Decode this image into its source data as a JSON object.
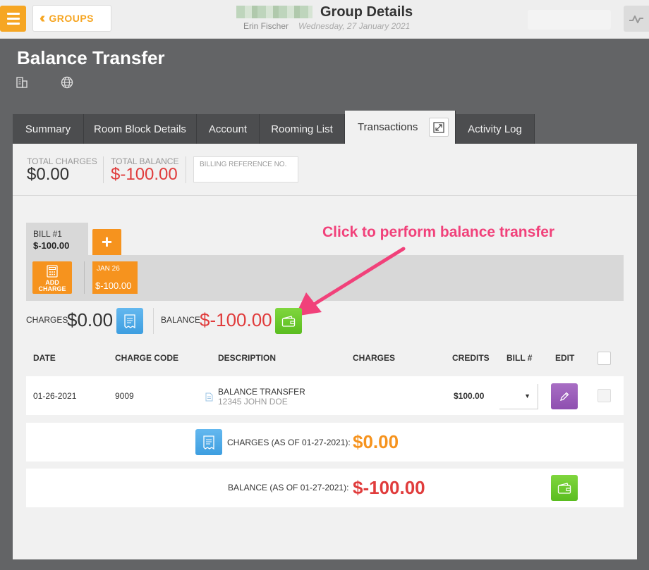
{
  "topbar": {
    "groups_label": "GROUPS",
    "title": "Group Details",
    "user": "Erin Fischer",
    "date": "Wednesday, 27 January 2021"
  },
  "header": {
    "title": "Balance Transfer"
  },
  "tabs": [
    {
      "label": "Summary"
    },
    {
      "label": "Room Block Details"
    },
    {
      "label": "Account"
    },
    {
      "label": "Rooming List"
    },
    {
      "label": "Transactions"
    },
    {
      "label": "Activity Log"
    }
  ],
  "summary": {
    "total_charges_label": "TOTAL CHARGES",
    "total_charges_value": "$0.00",
    "total_balance_label": "TOTAL BALANCE",
    "total_balance_value": "$-100.00",
    "billing_ref_label": "BILLING REFERENCE NO."
  },
  "bill": {
    "label": "BILL #1",
    "amount": "$-100.00",
    "add_charge_label_1": "ADD",
    "add_charge_label_2": "CHARGE",
    "folio_date": "JAN 26",
    "folio_amount": "$-100.00"
  },
  "annotation": "Click to perform balance transfer",
  "totals": {
    "charges_label": "CHARGES",
    "charges_value": "$0.00",
    "balance_label": "BALANCE",
    "balance_value": "$-100.00"
  },
  "table": {
    "headers": [
      "DATE",
      "CHARGE CODE",
      "DESCRIPTION",
      "CHARGES",
      "CREDITS",
      "BILL #",
      "EDIT"
    ],
    "rows": [
      {
        "date": "01-26-2021",
        "code": "9009",
        "description": "BALANCE TRANSFER",
        "sub": "12345 JOHN DOE",
        "charges": "",
        "credits": "$100.00"
      }
    ]
  },
  "footer": {
    "charges_label": "CHARGES (AS OF 01-27-2021):",
    "charges_value": "$0.00",
    "balance_label": "BALANCE (AS OF 01-27-2021):",
    "balance_value": "$-100.00"
  },
  "colors": {
    "accent_orange": "#f6931e",
    "negative_red": "#e03c3c",
    "annotation_pink": "#f1417a",
    "transfer_green": "#5bbd20"
  }
}
